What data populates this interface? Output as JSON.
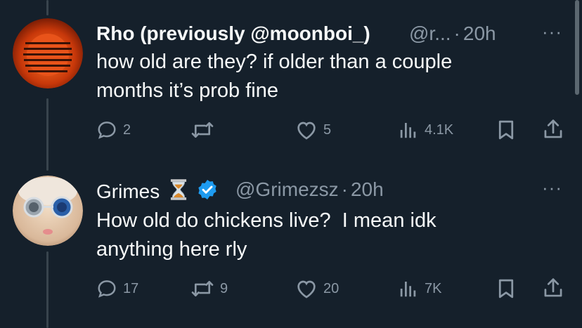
{
  "tweets": [
    {
      "display_name": "Rho (previously @moonboi_)",
      "handle": "@r...",
      "separator": "·",
      "time": "20h",
      "more": "···",
      "text_line1": "how old are they? if older than a couple",
      "text_line2": "months it’s prob fine",
      "replies": "2",
      "reposts": "",
      "likes": "5",
      "views": "4.1K"
    },
    {
      "display_name": "Grimes",
      "handle": "@Grimezsz",
      "separator": "·",
      "time": "20h",
      "more": "···",
      "text_line1": "How old do chickens live?  I mean idk",
      "text_line2": "anything here rly",
      "replies": "17",
      "reposts": "9",
      "likes": "20",
      "views": "7K"
    }
  ],
  "icons": {
    "reply": "reply-icon",
    "repost": "repost-icon",
    "like": "like-icon",
    "views": "views-icon",
    "bookmark": "bookmark-icon",
    "share": "share-icon",
    "verified": "verified-badge-icon",
    "hourglass": "hourglass-emoji-icon"
  },
  "colors": {
    "background": "#15202b",
    "text": "#f7f9f9",
    "muted": "#8b98a5",
    "verified": "#1d9bf0"
  }
}
